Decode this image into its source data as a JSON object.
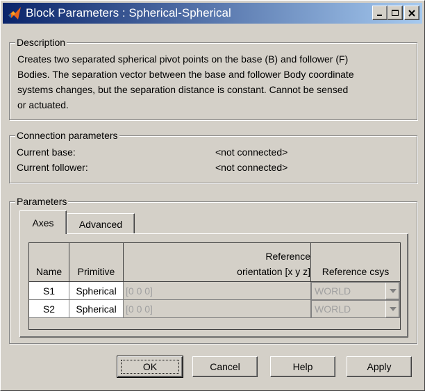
{
  "window": {
    "title": "Block Parameters : Spherical-Spherical"
  },
  "description": {
    "legend": "Description",
    "lines": [
      "Creates two separated spherical pivot points on the base (B) and follower (F)",
      "Bodies. The separation vector between the base and follower Body coordinate",
      "systems changes, but the separation distance is constant. Cannot be sensed",
      "or actuated."
    ]
  },
  "connection": {
    "legend": "Connection parameters",
    "base_label": "Current base:",
    "base_value": "<not connected>",
    "follower_label": "Current follower:",
    "follower_value": "<not connected>"
  },
  "parameters": {
    "legend": "Parameters",
    "tabs": [
      {
        "label": "Axes"
      },
      {
        "label": "Advanced"
      }
    ],
    "table": {
      "headers": {
        "name": "Name",
        "primitive": "Primitive",
        "orientation_line1": "Reference",
        "orientation_line2": "orientation [x y z]",
        "csys": "Reference csys"
      },
      "rows": [
        {
          "name": "S1",
          "primitive": "Spherical",
          "orientation": "[0 0 0]",
          "csys": "WORLD"
        },
        {
          "name": "S2",
          "primitive": "Spherical",
          "orientation": "[0 0 0]",
          "csys": "WORLD"
        }
      ]
    }
  },
  "buttons": {
    "ok": "OK",
    "cancel": "Cancel",
    "help": "Help",
    "apply": "Apply"
  },
  "icons": [
    "matlab-logo-icon",
    "minimize-icon",
    "maximize-icon",
    "close-icon",
    "dropdown-arrow-icon"
  ],
  "colors": {
    "title_start": "#0a246a",
    "title_end": "#a6caf0",
    "face": "#d4d0c8"
  }
}
